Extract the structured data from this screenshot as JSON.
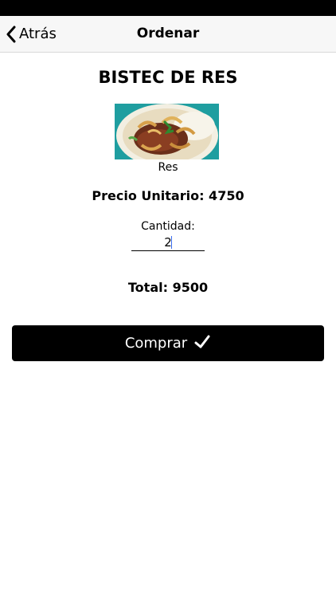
{
  "nav": {
    "back_label": "Atrás",
    "title": "Ordenar"
  },
  "product": {
    "name": "BISTEC DE RES",
    "category": "Res",
    "unit_price_text": "Precio Unitario: 4750"
  },
  "quantity": {
    "label": "Cantidad:",
    "value": "2"
  },
  "order": {
    "total_text": "Total: 9500",
    "buy_label": "Comprar"
  },
  "icons": {
    "back": "chevron-left-icon",
    "buy": "checkmark-icon"
  },
  "colors": {
    "status_bar": "#000000",
    "nav_bar": "#f7f7f7",
    "button": "#000000",
    "button_text": "#ffffff",
    "image_bg": "#1f9ea0"
  }
}
